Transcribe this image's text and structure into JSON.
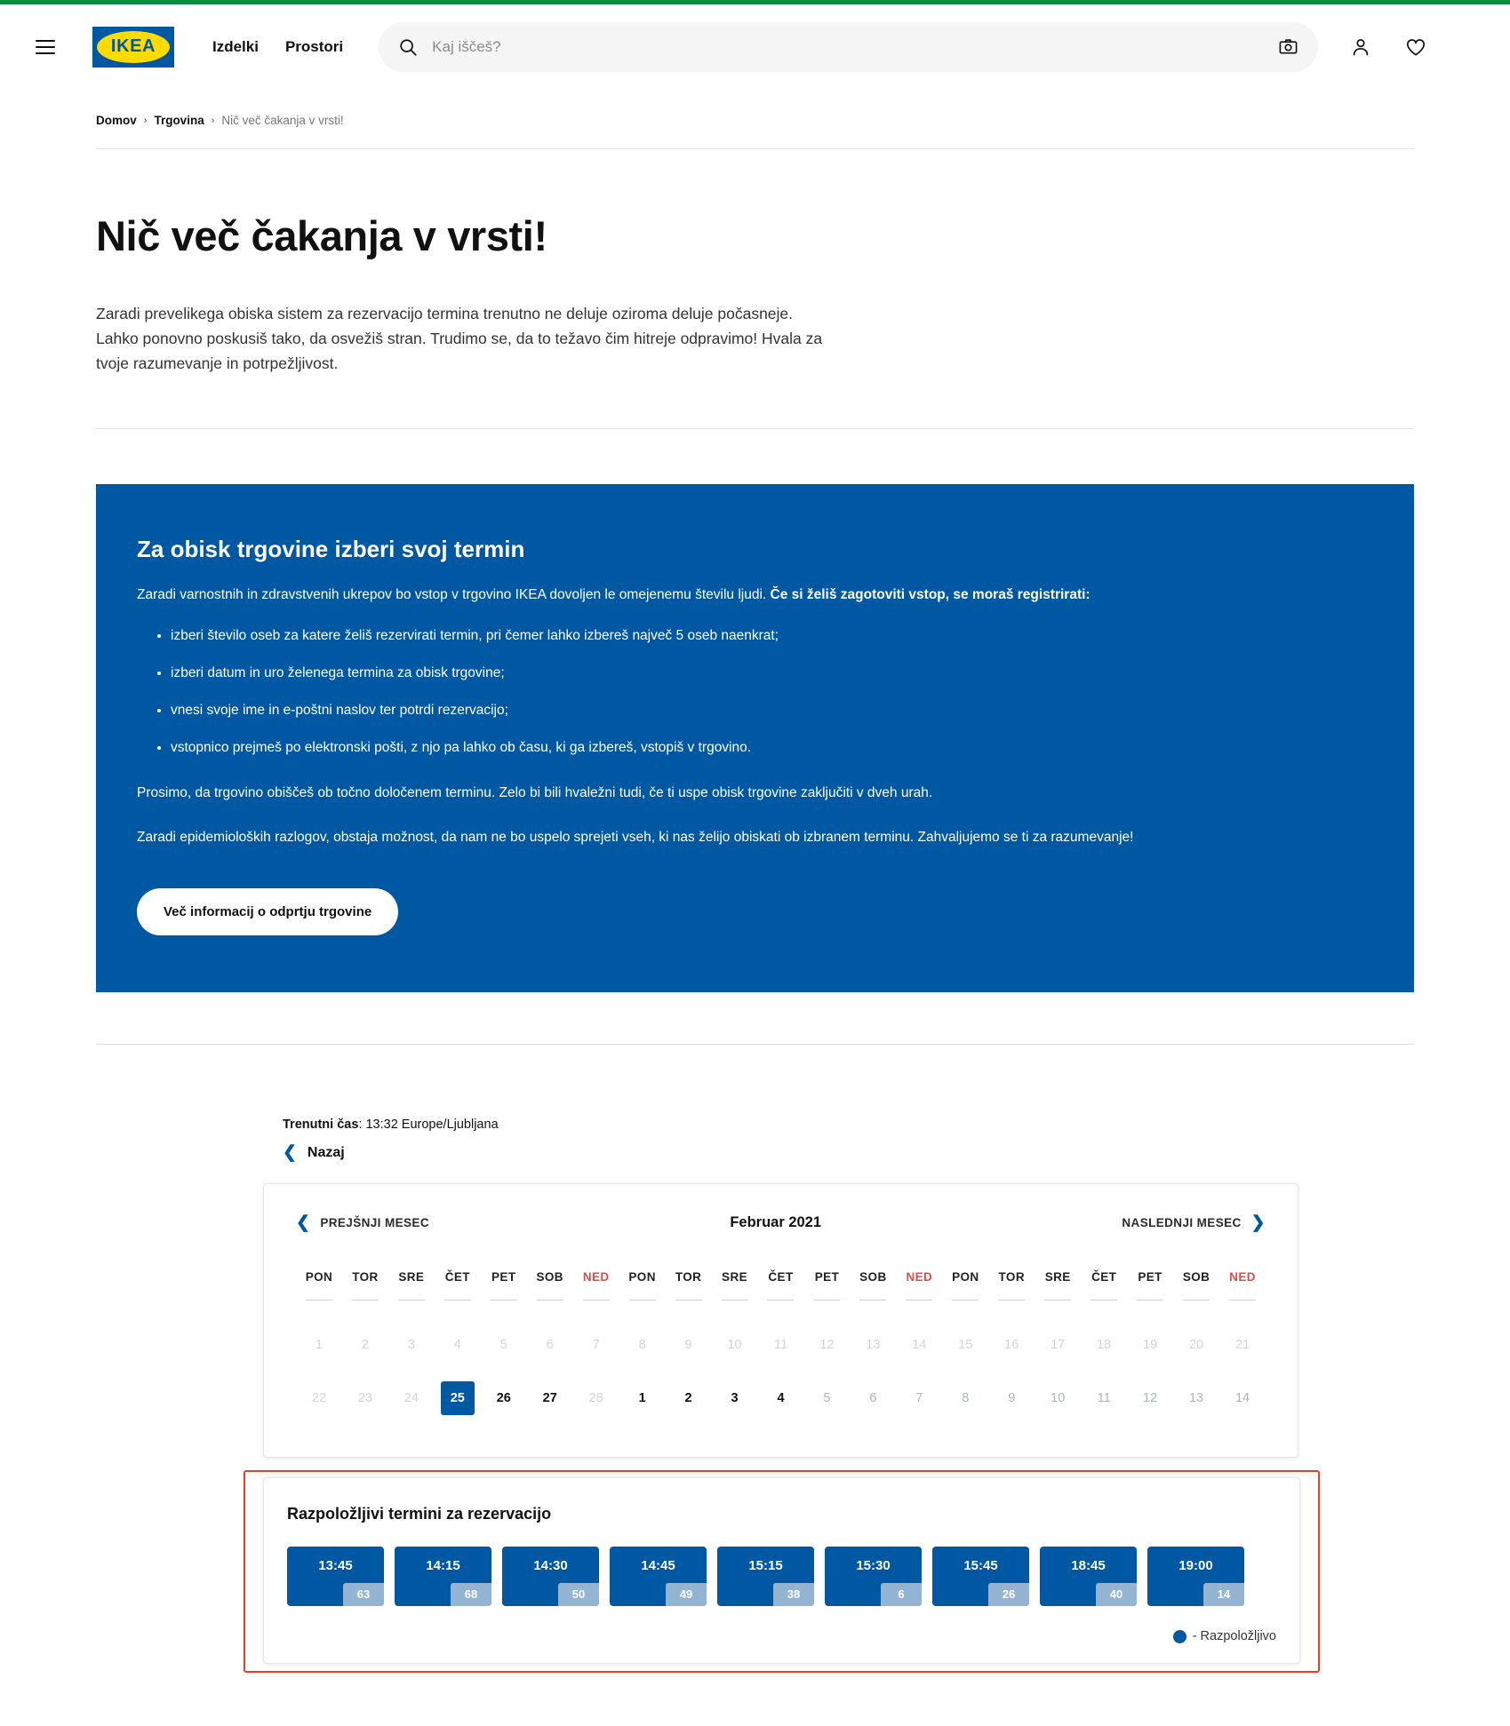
{
  "colors": {
    "ikea_blue": "#0058a3",
    "ikea_yellow": "#ffdb00",
    "accent_green": "#0a8a3c",
    "highlight_red": "#f03d1e",
    "sunday_red": "#e34a4a",
    "slot_count_blue": "#94b4d4"
  },
  "header": {
    "menu_icon": "hamburger-menu-icon",
    "logo_text": "IKEA",
    "nav": [
      {
        "label": "Izdelki"
      },
      {
        "label": "Prostori"
      }
    ],
    "search": {
      "placeholder": "Kaj iščeš?",
      "value": "",
      "search_icon": "search-icon",
      "camera_icon": "camera-icon"
    },
    "account_icon": "user-account-icon",
    "favorites_icon": "heart-favorites-icon"
  },
  "breadcrumb": {
    "items": [
      {
        "label": "Domov"
      },
      {
        "label": "Trgovina"
      }
    ],
    "separator": "›",
    "current": "Nič več čakanja v vrsti!"
  },
  "intro": {
    "title": "Nič več čakanja v vrsti!",
    "paragraph": "Zaradi prevelikega obiska sistem za rezervacijo termina trenutno ne deluje oziroma deluje počasneje. Lahko ponovno poskusiš tako, da osvežiš stran. Trudimo se, da to težavo čim hitreje odpravimo! Hvala za tvoje razumevanje in potrpežljivost."
  },
  "promo": {
    "heading": "Za obisk trgovine izberi svoj termin",
    "lead_plain": "Zaradi varnostnih in zdravstvenih ukrepov bo vstop v trgovino IKEA dovoljen le omejenemu številu ljudi. ",
    "lead_bold": "Če si želiš zagotoviti vstop, se moraš registrirati:",
    "bullets": [
      "izberi število oseb za katere želiš rezervirati termin, pri čemer lahko izbereš največ 5 oseb naenkrat;",
      "izberi datum in uro želenega termina za obisk trgovine;",
      "vnesi svoje ime in e-poštni naslov ter potrdi rezervacijo;",
      "vstopnico prejmeš po elektronski pošti, z njo pa lahko ob času, ki ga izbereš, vstopiš v trgovino."
    ],
    "paragraph_1": "Prosimo, da trgovino obiščeš ob točno določenem terminu. Zelo bi bili hvaležni tudi, če ti uspe obisk trgovine zaključiti v dveh urah.",
    "paragraph_2": "Zaradi epidemioloških razlogov, obstaja možnost, da nam ne bo uspelo sprejeti vseh, ki nas želijo obiskati ob izbranem terminu. Zahvaljujemo se ti za razumevanje!",
    "button_label": "Več informacij o odprtju trgovine"
  },
  "booking": {
    "current_time_label": "Trenutni čas",
    "current_time_value": ": 13:32 Europe/Ljubljana",
    "back_label": "Nazaj",
    "back_icon": "chevron-left-icon",
    "calendar": {
      "prev_label": "PREJŠNJI MESEC",
      "prev_icon": "chevron-left-icon",
      "next_label": "NASLEDNJI MESEC",
      "next_icon": "chevron-right-icon",
      "month_label": "Februar 2021",
      "weekdays": [
        {
          "label": "PON",
          "sunday": false
        },
        {
          "label": "TOR",
          "sunday": false
        },
        {
          "label": "SRE",
          "sunday": false
        },
        {
          "label": "ČET",
          "sunday": false
        },
        {
          "label": "PET",
          "sunday": false
        },
        {
          "label": "SOB",
          "sunday": false
        },
        {
          "label": "NED",
          "sunday": true
        },
        {
          "label": "PON",
          "sunday": false
        },
        {
          "label": "TOR",
          "sunday": false
        },
        {
          "label": "SRE",
          "sunday": false
        },
        {
          "label": "ČET",
          "sunday": false
        },
        {
          "label": "PET",
          "sunday": false
        },
        {
          "label": "SOB",
          "sunday": false
        },
        {
          "label": "NED",
          "sunday": true
        },
        {
          "label": "PON",
          "sunday": false
        },
        {
          "label": "TOR",
          "sunday": false
        },
        {
          "label": "SRE",
          "sunday": false
        },
        {
          "label": "ČET",
          "sunday": false
        },
        {
          "label": "PET",
          "sunday": false
        },
        {
          "label": "SOB",
          "sunday": false
        },
        {
          "label": "NED",
          "sunday": true
        }
      ],
      "row1": [
        {
          "day": "1",
          "state": "disabled"
        },
        {
          "day": "2",
          "state": "disabled"
        },
        {
          "day": "3",
          "state": "disabled"
        },
        {
          "day": "4",
          "state": "disabled"
        },
        {
          "day": "5",
          "state": "disabled"
        },
        {
          "day": "6",
          "state": "disabled"
        },
        {
          "day": "7",
          "state": "disabled"
        },
        {
          "day": "8",
          "state": "disabled"
        },
        {
          "day": "9",
          "state": "disabled"
        },
        {
          "day": "10",
          "state": "disabled"
        },
        {
          "day": "11",
          "state": "disabled"
        },
        {
          "day": "12",
          "state": "disabled"
        },
        {
          "day": "13",
          "state": "disabled"
        },
        {
          "day": "14",
          "state": "disabled"
        },
        {
          "day": "15",
          "state": "disabled"
        },
        {
          "day": "16",
          "state": "disabled"
        },
        {
          "day": "17",
          "state": "disabled"
        },
        {
          "day": "18",
          "state": "disabled"
        },
        {
          "day": "19",
          "state": "disabled"
        },
        {
          "day": "20",
          "state": "disabled"
        },
        {
          "day": "21",
          "state": "disabled"
        }
      ],
      "row2": [
        {
          "day": "22",
          "state": "disabled"
        },
        {
          "day": "23",
          "state": "disabled"
        },
        {
          "day": "24",
          "state": "disabled"
        },
        {
          "day": "25",
          "state": "selected"
        },
        {
          "day": "26",
          "state": "normal"
        },
        {
          "day": "27",
          "state": "normal"
        },
        {
          "day": "28",
          "state": "disabled"
        },
        {
          "day": "1",
          "state": "normal"
        },
        {
          "day": "2",
          "state": "normal"
        },
        {
          "day": "3",
          "state": "normal"
        },
        {
          "day": "4",
          "state": "normal"
        },
        {
          "day": "5",
          "state": "muted"
        },
        {
          "day": "6",
          "state": "muted"
        },
        {
          "day": "7",
          "state": "muted"
        },
        {
          "day": "8",
          "state": "muted"
        },
        {
          "day": "9",
          "state": "muted"
        },
        {
          "day": "10",
          "state": "muted"
        },
        {
          "day": "11",
          "state": "muted"
        },
        {
          "day": "12",
          "state": "muted"
        },
        {
          "day": "13",
          "state": "muted"
        },
        {
          "day": "14",
          "state": "muted"
        }
      ]
    },
    "slots": {
      "title": "Razpoložljivi termini za rezervacijo",
      "items": [
        {
          "time": "13:45",
          "count": "63"
        },
        {
          "time": "14:15",
          "count": "68"
        },
        {
          "time": "14:30",
          "count": "50"
        },
        {
          "time": "14:45",
          "count": "49"
        },
        {
          "time": "15:15",
          "count": "38"
        },
        {
          "time": "15:30",
          "count": "6"
        },
        {
          "time": "15:45",
          "count": "26"
        },
        {
          "time": "18:45",
          "count": "40"
        },
        {
          "time": "19:00",
          "count": "14"
        }
      ],
      "legend_label": "- Razpoložljivo"
    }
  }
}
